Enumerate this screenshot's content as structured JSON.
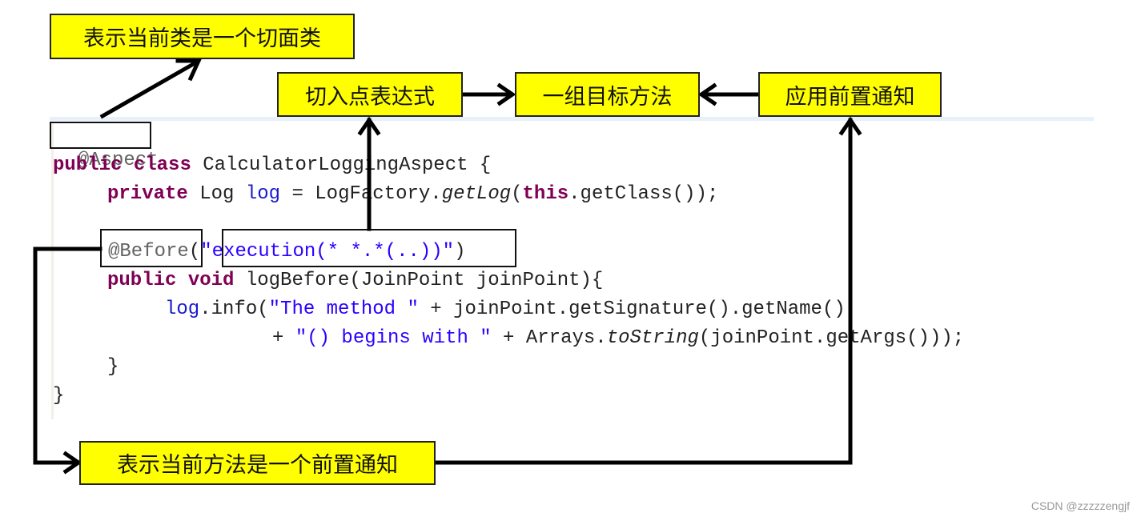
{
  "callouts": {
    "aspect_class": "表示当前类是一个切面类",
    "pointcut_expression": "切入点表达式",
    "target_methods": "一组目标方法",
    "apply_before_advice": "应用前置通知",
    "before_advice_method": "表示当前方法是一个前置通知"
  },
  "code": {
    "line1": {
      "annotation": "@Aspect"
    },
    "line2": {
      "kw1": "public",
      "kw2": "class",
      "rest": " CalculatorLoggingAspect {"
    },
    "line3": {
      "kw": "private",
      "type": " Log ",
      "field": "log",
      "mid": " = LogFactory.",
      "method": "getLog",
      "open": "(",
      "kw_this": "this",
      "rest": ".getClass());"
    },
    "line5": {
      "annotation": "@Before",
      "open": "(",
      "string": "\"execution(* *.*(..))\"",
      "close": ")"
    },
    "line6": {
      "kw1": "public",
      "kw2": "void",
      "rest": " logBefore(JoinPoint joinPoint){"
    },
    "line7": {
      "field": "log",
      "mid": ".info(",
      "string": "\"The method \"",
      "rest": " + joinPoint.getSignature().getName()"
    },
    "line8": {
      "plus": "+ ",
      "string": "\"() begins with \"",
      "mid": " + Arrays.",
      "method": "toString",
      "rest": "(joinPoint.getArgs()));"
    },
    "line9": {
      "brace": "}"
    },
    "line10": {
      "brace": "}"
    }
  },
  "watermark": "CSDN @zzzzzengjf"
}
